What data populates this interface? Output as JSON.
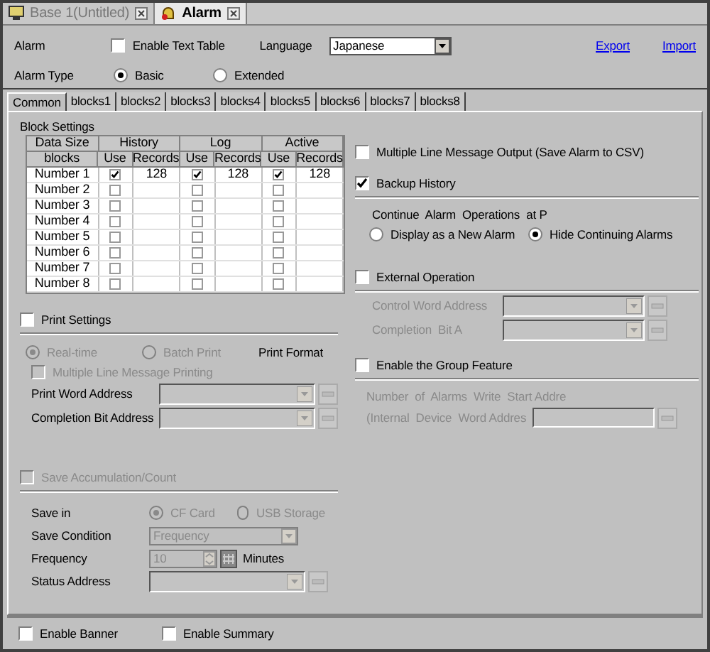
{
  "doc_tabs": [
    {
      "label": "Base 1(Untitled)",
      "selected": false,
      "kind": "screen"
    },
    {
      "label": "Alarm",
      "selected": true,
      "kind": "alarm"
    }
  ],
  "header": {
    "alarm_label": "Alarm",
    "enable_text_table": {
      "label": "Enable Text Table",
      "checked": false
    },
    "language_label": "Language",
    "language": "Japanese",
    "export": "Export",
    "import": "Import",
    "alarm_type_label": "Alarm Type",
    "alarm_types": [
      {
        "label": "Basic",
        "selected": true
      },
      {
        "label": "Extended",
        "selected": false
      }
    ]
  },
  "tabs": [
    {
      "label": "Common",
      "selected": true
    },
    {
      "label": "blocks1",
      "selected": false
    },
    {
      "label": "blocks2",
      "selected": false
    },
    {
      "label": "blocks3",
      "selected": false
    },
    {
      "label": "blocks4",
      "selected": false
    },
    {
      "label": "blocks5",
      "selected": false
    },
    {
      "label": "blocks6",
      "selected": false
    },
    {
      "label": "blocks7",
      "selected": false
    },
    {
      "label": "blocks8",
      "selected": false
    }
  ],
  "block_settings": {
    "title": "Block Settings",
    "header_row1": [
      "Data Size",
      "History",
      "Log",
      "Active"
    ],
    "header_row2": [
      "blocks",
      "Use",
      "Records",
      "Use",
      "Records",
      "Use",
      "Records"
    ],
    "rows": [
      {
        "name": "Number 1",
        "cells": [
          {
            "use": true,
            "records": "128"
          },
          {
            "use": true,
            "records": "128"
          },
          {
            "use": true,
            "records": "128"
          }
        ]
      },
      {
        "name": "Number 2",
        "cells": [
          {
            "use": false
          },
          {
            "use": false
          },
          {
            "use": false
          }
        ]
      },
      {
        "name": "Number 3",
        "cells": [
          {
            "use": false
          },
          {
            "use": false
          },
          {
            "use": false
          }
        ]
      },
      {
        "name": "Number 4",
        "cells": [
          {
            "use": false
          },
          {
            "use": false
          },
          {
            "use": false
          }
        ]
      },
      {
        "name": "Number 5",
        "cells": [
          {
            "use": false
          },
          {
            "use": false
          },
          {
            "use": false
          }
        ]
      },
      {
        "name": "Number 6",
        "cells": [
          {
            "use": false
          },
          {
            "use": false
          },
          {
            "use": false
          }
        ]
      },
      {
        "name": "Number 7",
        "cells": [
          {
            "use": false
          },
          {
            "use": false
          },
          {
            "use": false
          }
        ]
      },
      {
        "name": "Number 8",
        "cells": [
          {
            "use": false
          },
          {
            "use": false
          },
          {
            "use": false
          }
        ]
      }
    ]
  },
  "print_settings": {
    "label": "Print Settings",
    "checked": false,
    "disabled": true,
    "modes": [
      {
        "label": "Real-time",
        "selected": true
      },
      {
        "label": "Batch Print",
        "selected": false
      }
    ],
    "print_format": "Print Format",
    "multi_line": {
      "label": "Multiple Line Message Printing",
      "checked": false
    },
    "fields": [
      {
        "label": "Print Word Address"
      },
      {
        "label": "Completion Bit Address"
      }
    ]
  },
  "save_accumulation": {
    "label": "Save Accumulation/Count",
    "checked": false,
    "disabled": true,
    "save_in_label": "Save in",
    "save_in": [
      {
        "label": "CF Card",
        "selected": true
      },
      {
        "label": "USB Storage",
        "selected": false
      }
    ],
    "save_condition_label": "Save Condition",
    "save_condition": "Frequency",
    "frequency_label": "Frequency",
    "frequency": "10",
    "frequency_unit": "Minutes",
    "status_address_label": "Status Address"
  },
  "multi_line_output": {
    "label": "Multiple Line Message Output (Save Alarm to CSV)",
    "checked": false
  },
  "backup_history": {
    "label": "Backup History",
    "checked": true,
    "continue_label": "Continue  Alarm  Operations  at P",
    "options": [
      {
        "label": "Display as a New Alarm",
        "selected": false
      },
      {
        "label": "Hide Continuing Alarms",
        "selected": true
      }
    ]
  },
  "external_operation": {
    "label": "External Operation",
    "checked": false,
    "disabled": true,
    "fields": [
      {
        "label": "Control Word Address"
      },
      {
        "label": "Completion  Bit A"
      }
    ]
  },
  "group_feature": {
    "label": "Enable the Group Feature",
    "checked": false,
    "disabled": true,
    "line1": "Number  of  Alarms  Write  Start Addre",
    "field_label": "(Internal  Device  Word Addres"
  },
  "bottom": [
    {
      "label": "Enable Banner",
      "checked": false
    },
    {
      "label": "Enable Summary",
      "checked": false
    }
  ]
}
